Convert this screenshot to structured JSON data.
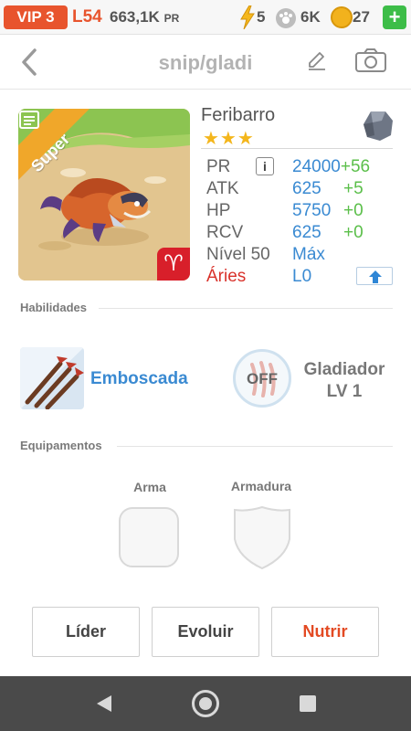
{
  "status": {
    "vip": "VIP 3",
    "level": "L54",
    "power": "663,1K",
    "power_unit": "PR",
    "energy": "5",
    "paws": "6K",
    "coins": "27",
    "add": "+"
  },
  "header": {
    "title": "snip/gladi",
    "icons": [
      "back-arrow-icon",
      "pencil-icon",
      "camera-icon"
    ]
  },
  "monster": {
    "ribbon": "Super",
    "name": "Feribarro",
    "stars": "★★★",
    "zodiac_glyph": "♈",
    "element_icon": "rock-element-icon",
    "stats": [
      {
        "label": "PR",
        "value": "24000",
        "bonus": "+56"
      },
      {
        "label": "ATK",
        "value": "625",
        "bonus": "+5"
      },
      {
        "label": "HP",
        "value": "5750",
        "bonus": "+0"
      },
      {
        "label": "RCV",
        "value": "625",
        "bonus": "+0"
      }
    ],
    "info_button": "i",
    "level_label": "Nível 50",
    "level_value": "Máx",
    "sign_label": "Áries",
    "sign_value": "L0"
  },
  "abilities": {
    "heading": "Habilidades",
    "active_skill": "Emboscada",
    "passive_status": "OFF",
    "passive_name": "Gladiador",
    "passive_level": "LV 1"
  },
  "equipment": {
    "heading": "Equipamentos",
    "weapon_label": "Arma",
    "armor_label": "Armadura"
  },
  "actions": {
    "leader": "Líder",
    "evolve": "Evoluir",
    "feed": "Nutrir"
  },
  "colors": {
    "accent_orange": "#e8542d",
    "stat_blue": "#3a8ad2",
    "bonus_green": "#5bbf4a",
    "aries_red": "#d9322b"
  }
}
